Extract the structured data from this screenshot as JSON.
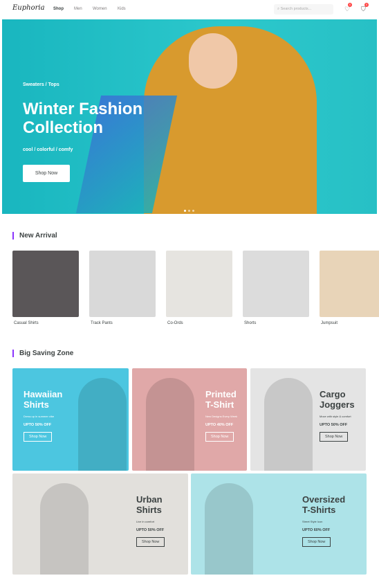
{
  "header": {
    "logo": "Euphoria",
    "nav": [
      "Shop",
      "Men",
      "Women",
      "Kids"
    ],
    "search_placeholder": "Search products...",
    "wishlist_count": "0",
    "cart_count": "0"
  },
  "hero": {
    "category": "Sweaters / Tops",
    "title": "Winter Fashion Collection",
    "tagline": "cool / colorful / comfy",
    "button": "Shop Now",
    "slides": 3
  },
  "new_arrival": {
    "heading": "New Arrival",
    "items": [
      {
        "label": "Casual Shirts",
        "color": "#5a5658"
      },
      {
        "label": "Track Pants",
        "color": "#d9d9d9"
      },
      {
        "label": "Co-Ords",
        "color": "#e6e4e0"
      },
      {
        "label": "Shorts",
        "color": "#dcdcdc"
      },
      {
        "label": "Jumpsuit",
        "color": "#e8d4b8"
      }
    ]
  },
  "saving": {
    "heading": "Big Saving Zone",
    "cards": [
      {
        "title1": "Hawaiian",
        "title2": "Shirts",
        "desc": "Dress up in summer vibe",
        "offer": "UPTO 50% OFF",
        "button": "Shop Now",
        "bg": "#4cc6e0",
        "text": "#ffffff"
      },
      {
        "title1": "Printed",
        "title2": "T-Shirt",
        "desc": "New Designs Every Week",
        "offer": "UPTO 40% OFF",
        "button": "Shop Now",
        "bg": "#e0a8a8",
        "text": "#ffffff"
      },
      {
        "title1": "Cargo",
        "title2": "Joggers",
        "desc": "Move with style & comfort",
        "offer": "UPTO 50% OFF",
        "button": "Shop Now",
        "bg": "#e4e4e4",
        "text": "#3c4242"
      },
      {
        "title1": "Urban",
        "title2": "Shirts",
        "desc": "Live in comfort",
        "offer": "UPTO 50% OFF",
        "button": "Shop Now",
        "bg": "#e2e0dc",
        "text": "#3c4242"
      },
      {
        "title1": "Oversized",
        "title2": "T-Shirts",
        "desc": "Street Style Icon",
        "offer": "UPTO 60% OFF",
        "button": "Shop Now",
        "bg": "#ade3e8",
        "text": "#3c4242"
      }
    ]
  }
}
